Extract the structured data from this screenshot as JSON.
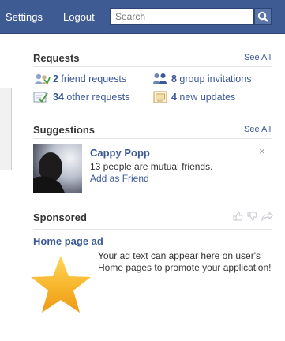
{
  "topbar": {
    "settings": "Settings",
    "logout": "Logout",
    "search_placeholder": "Search",
    "search_icon": "search-icon"
  },
  "requests": {
    "heading": "Requests",
    "see_all": "See All",
    "items": [
      {
        "count": "2",
        "label": " friend requests",
        "icon": "friend-request-icon"
      },
      {
        "count": "8",
        "label": " group invitations",
        "icon": "group-icon"
      },
      {
        "count": "34",
        "label": " other requests",
        "icon": "other-requests-icon"
      },
      {
        "count": "4",
        "label": " new updates",
        "icon": "updates-icon"
      }
    ]
  },
  "suggestions": {
    "heading": "Suggestions",
    "see_all": "See All",
    "person": {
      "name": "Cappy Popp",
      "mutual": "13 people are mutual friends.",
      "action": "Add as Friend",
      "dismiss": "×"
    }
  },
  "sponsored": {
    "heading": "Sponsored",
    "social_icons": [
      "thumbs-up-icon",
      "thumbs-down-icon",
      "share-icon"
    ],
    "ad": {
      "title": "Home page ad",
      "text": "Your ad text can appear here on user's Home pages to promote your application!",
      "image": "star-icon"
    }
  }
}
